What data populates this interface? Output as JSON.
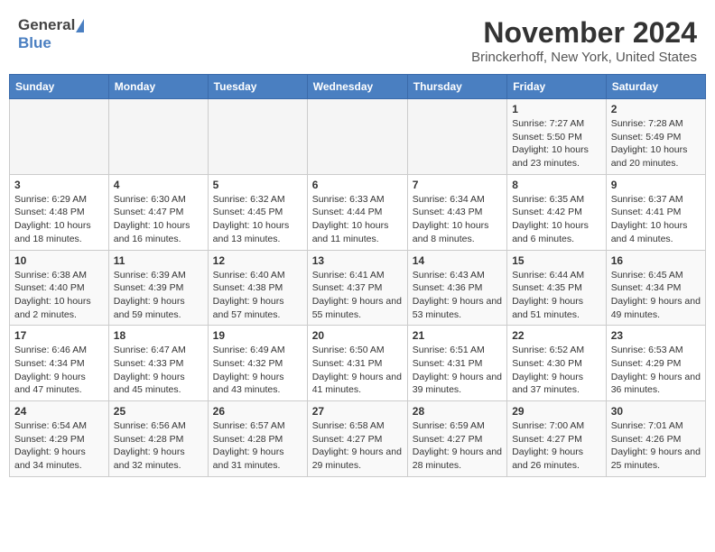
{
  "header": {
    "logo_general": "General",
    "logo_blue": "Blue",
    "title": "November 2024",
    "subtitle": "Brinckerhoff, New York, United States"
  },
  "calendar": {
    "days_of_week": [
      "Sunday",
      "Monday",
      "Tuesday",
      "Wednesday",
      "Thursday",
      "Friday",
      "Saturday"
    ],
    "weeks": [
      [
        {
          "day": "",
          "info": ""
        },
        {
          "day": "",
          "info": ""
        },
        {
          "day": "",
          "info": ""
        },
        {
          "day": "",
          "info": ""
        },
        {
          "day": "",
          "info": ""
        },
        {
          "day": "1",
          "info": "Sunrise: 7:27 AM\nSunset: 5:50 PM\nDaylight: 10 hours and 23 minutes."
        },
        {
          "day": "2",
          "info": "Sunrise: 7:28 AM\nSunset: 5:49 PM\nDaylight: 10 hours and 20 minutes."
        }
      ],
      [
        {
          "day": "3",
          "info": "Sunrise: 6:29 AM\nSunset: 4:48 PM\nDaylight: 10 hours and 18 minutes."
        },
        {
          "day": "4",
          "info": "Sunrise: 6:30 AM\nSunset: 4:47 PM\nDaylight: 10 hours and 16 minutes."
        },
        {
          "day": "5",
          "info": "Sunrise: 6:32 AM\nSunset: 4:45 PM\nDaylight: 10 hours and 13 minutes."
        },
        {
          "day": "6",
          "info": "Sunrise: 6:33 AM\nSunset: 4:44 PM\nDaylight: 10 hours and 11 minutes."
        },
        {
          "day": "7",
          "info": "Sunrise: 6:34 AM\nSunset: 4:43 PM\nDaylight: 10 hours and 8 minutes."
        },
        {
          "day": "8",
          "info": "Sunrise: 6:35 AM\nSunset: 4:42 PM\nDaylight: 10 hours and 6 minutes."
        },
        {
          "day": "9",
          "info": "Sunrise: 6:37 AM\nSunset: 4:41 PM\nDaylight: 10 hours and 4 minutes."
        }
      ],
      [
        {
          "day": "10",
          "info": "Sunrise: 6:38 AM\nSunset: 4:40 PM\nDaylight: 10 hours and 2 minutes."
        },
        {
          "day": "11",
          "info": "Sunrise: 6:39 AM\nSunset: 4:39 PM\nDaylight: 9 hours and 59 minutes."
        },
        {
          "day": "12",
          "info": "Sunrise: 6:40 AM\nSunset: 4:38 PM\nDaylight: 9 hours and 57 minutes."
        },
        {
          "day": "13",
          "info": "Sunrise: 6:41 AM\nSunset: 4:37 PM\nDaylight: 9 hours and 55 minutes."
        },
        {
          "day": "14",
          "info": "Sunrise: 6:43 AM\nSunset: 4:36 PM\nDaylight: 9 hours and 53 minutes."
        },
        {
          "day": "15",
          "info": "Sunrise: 6:44 AM\nSunset: 4:35 PM\nDaylight: 9 hours and 51 minutes."
        },
        {
          "day": "16",
          "info": "Sunrise: 6:45 AM\nSunset: 4:34 PM\nDaylight: 9 hours and 49 minutes."
        }
      ],
      [
        {
          "day": "17",
          "info": "Sunrise: 6:46 AM\nSunset: 4:34 PM\nDaylight: 9 hours and 47 minutes."
        },
        {
          "day": "18",
          "info": "Sunrise: 6:47 AM\nSunset: 4:33 PM\nDaylight: 9 hours and 45 minutes."
        },
        {
          "day": "19",
          "info": "Sunrise: 6:49 AM\nSunset: 4:32 PM\nDaylight: 9 hours and 43 minutes."
        },
        {
          "day": "20",
          "info": "Sunrise: 6:50 AM\nSunset: 4:31 PM\nDaylight: 9 hours and 41 minutes."
        },
        {
          "day": "21",
          "info": "Sunrise: 6:51 AM\nSunset: 4:31 PM\nDaylight: 9 hours and 39 minutes."
        },
        {
          "day": "22",
          "info": "Sunrise: 6:52 AM\nSunset: 4:30 PM\nDaylight: 9 hours and 37 minutes."
        },
        {
          "day": "23",
          "info": "Sunrise: 6:53 AM\nSunset: 4:29 PM\nDaylight: 9 hours and 36 minutes."
        }
      ],
      [
        {
          "day": "24",
          "info": "Sunrise: 6:54 AM\nSunset: 4:29 PM\nDaylight: 9 hours and 34 minutes."
        },
        {
          "day": "25",
          "info": "Sunrise: 6:56 AM\nSunset: 4:28 PM\nDaylight: 9 hours and 32 minutes."
        },
        {
          "day": "26",
          "info": "Sunrise: 6:57 AM\nSunset: 4:28 PM\nDaylight: 9 hours and 31 minutes."
        },
        {
          "day": "27",
          "info": "Sunrise: 6:58 AM\nSunset: 4:27 PM\nDaylight: 9 hours and 29 minutes."
        },
        {
          "day": "28",
          "info": "Sunrise: 6:59 AM\nSunset: 4:27 PM\nDaylight: 9 hours and 28 minutes."
        },
        {
          "day": "29",
          "info": "Sunrise: 7:00 AM\nSunset: 4:27 PM\nDaylight: 9 hours and 26 minutes."
        },
        {
          "day": "30",
          "info": "Sunrise: 7:01 AM\nSunset: 4:26 PM\nDaylight: 9 hours and 25 minutes."
        }
      ]
    ]
  }
}
